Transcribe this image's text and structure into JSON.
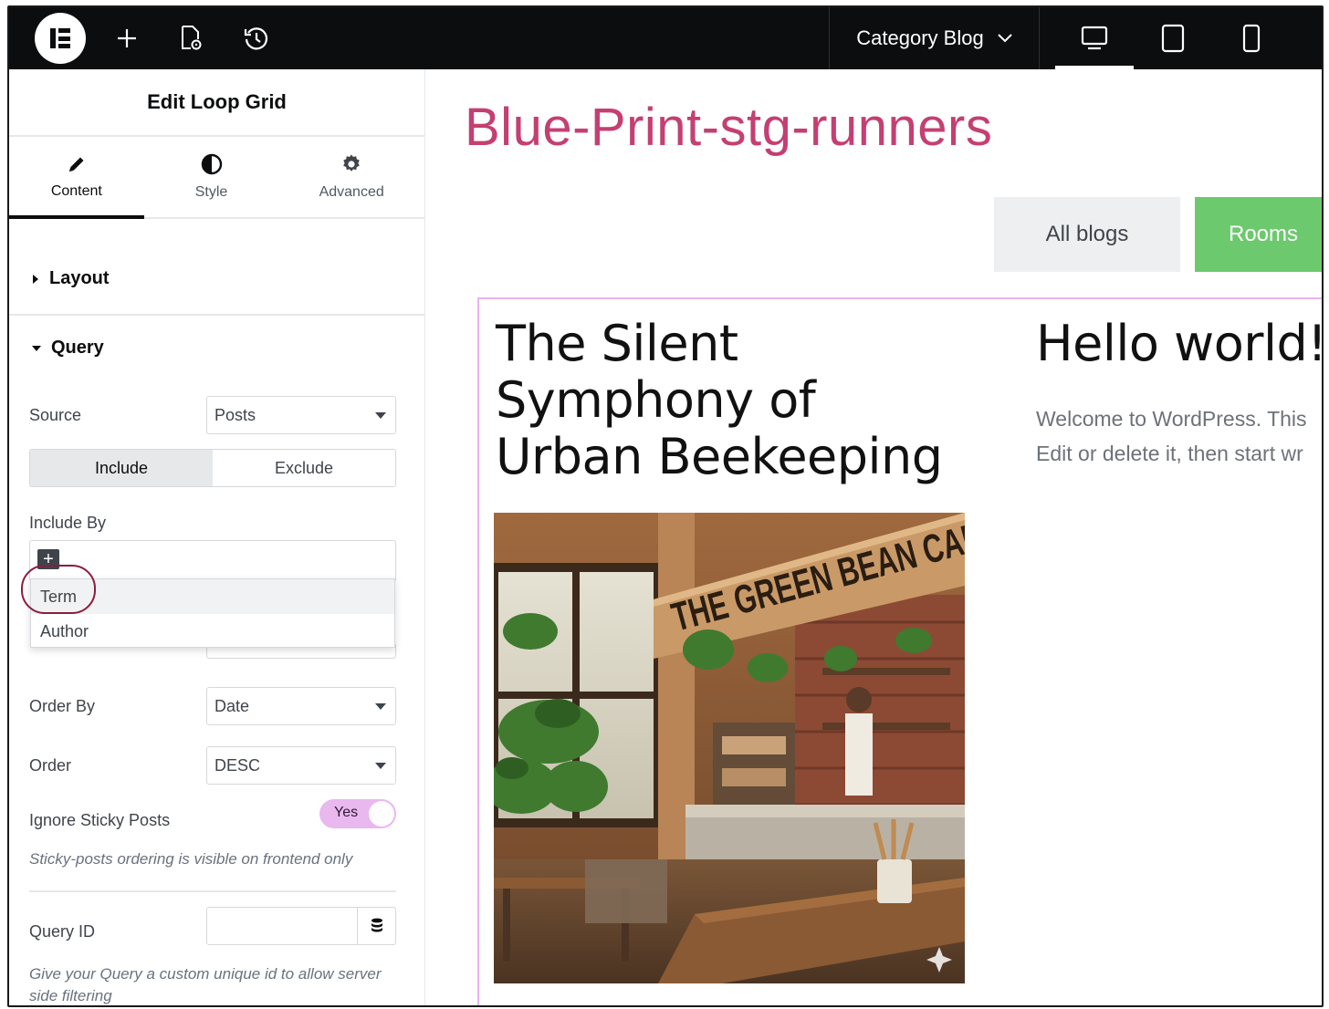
{
  "topbar": {
    "page_name": "Category Blog",
    "devices": [
      "desktop",
      "tablet",
      "mobile"
    ],
    "active_device": "desktop"
  },
  "panel": {
    "title": "Edit Loop Grid",
    "tabs": [
      {
        "label": "Content",
        "icon": "pencil-icon"
      },
      {
        "label": "Style",
        "icon": "half-circle-icon"
      },
      {
        "label": "Advanced",
        "icon": "gear-icon"
      }
    ],
    "active_tab": "Content",
    "sections": {
      "layout": "Layout",
      "query": "Query"
    },
    "source": {
      "label": "Source",
      "value": "Posts"
    },
    "include_exclude": {
      "include": "Include",
      "exclude": "Exclude",
      "active": "Include"
    },
    "include_by": {
      "label": "Include By",
      "options": [
        "Term",
        "Author"
      ],
      "highlighted": "Term"
    },
    "order_by": {
      "label": "Order By",
      "value": "Date"
    },
    "order": {
      "label": "Order",
      "value": "DESC"
    },
    "ignore_sticky": {
      "label": "Ignore Sticky Posts",
      "value": "Yes",
      "note": "Sticky-posts ordering is visible on frontend only"
    },
    "query_id": {
      "label": "Query ID",
      "value": "",
      "note": "Give your Query a custom unique id to allow server side filtering"
    }
  },
  "canvas": {
    "site_title": "Blue-Print-stg-runners",
    "filters": [
      {
        "label": "All blogs",
        "active": false
      },
      {
        "label": "Rooms",
        "active": true
      }
    ],
    "posts": [
      {
        "title": "The Silent Symphony of Urban Beekeeping",
        "image_sign": "THE GREEN BEAN CAFÉ"
      },
      {
        "title": "Hello world!",
        "excerpt_lines": [
          "Welcome to WordPress. This",
          "Edit or delete it, then start wr"
        ]
      }
    ]
  },
  "colors": {
    "topbar_bg": "#0c0d0e",
    "site_title": "#c43f72",
    "filter_active": "#6cc96e",
    "filter_inactive": "#eeeff0",
    "loop_outline": "#e8b2f0",
    "toggle_on": "#e9b8ee",
    "annotation_ring": "#8b1d3d"
  }
}
